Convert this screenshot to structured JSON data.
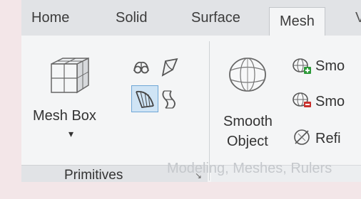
{
  "tabs": [
    {
      "label": "Home"
    },
    {
      "label": "Solid"
    },
    {
      "label": "Surface"
    },
    {
      "label": "Mesh"
    },
    {
      "label": "V"
    }
  ],
  "primitives": {
    "mesh_box_line1": "Mesh Box",
    "dropdown_glyph": "▾",
    "panel_title": "Primitives",
    "launcher_glyph": "↘"
  },
  "smooth": {
    "line1": "Smooth",
    "line2": "Object",
    "more_label": "Smo",
    "less_label": "Smo",
    "refine_label": "Refi"
  },
  "ghost_title": "Modeling, Meshes, Rulers"
}
